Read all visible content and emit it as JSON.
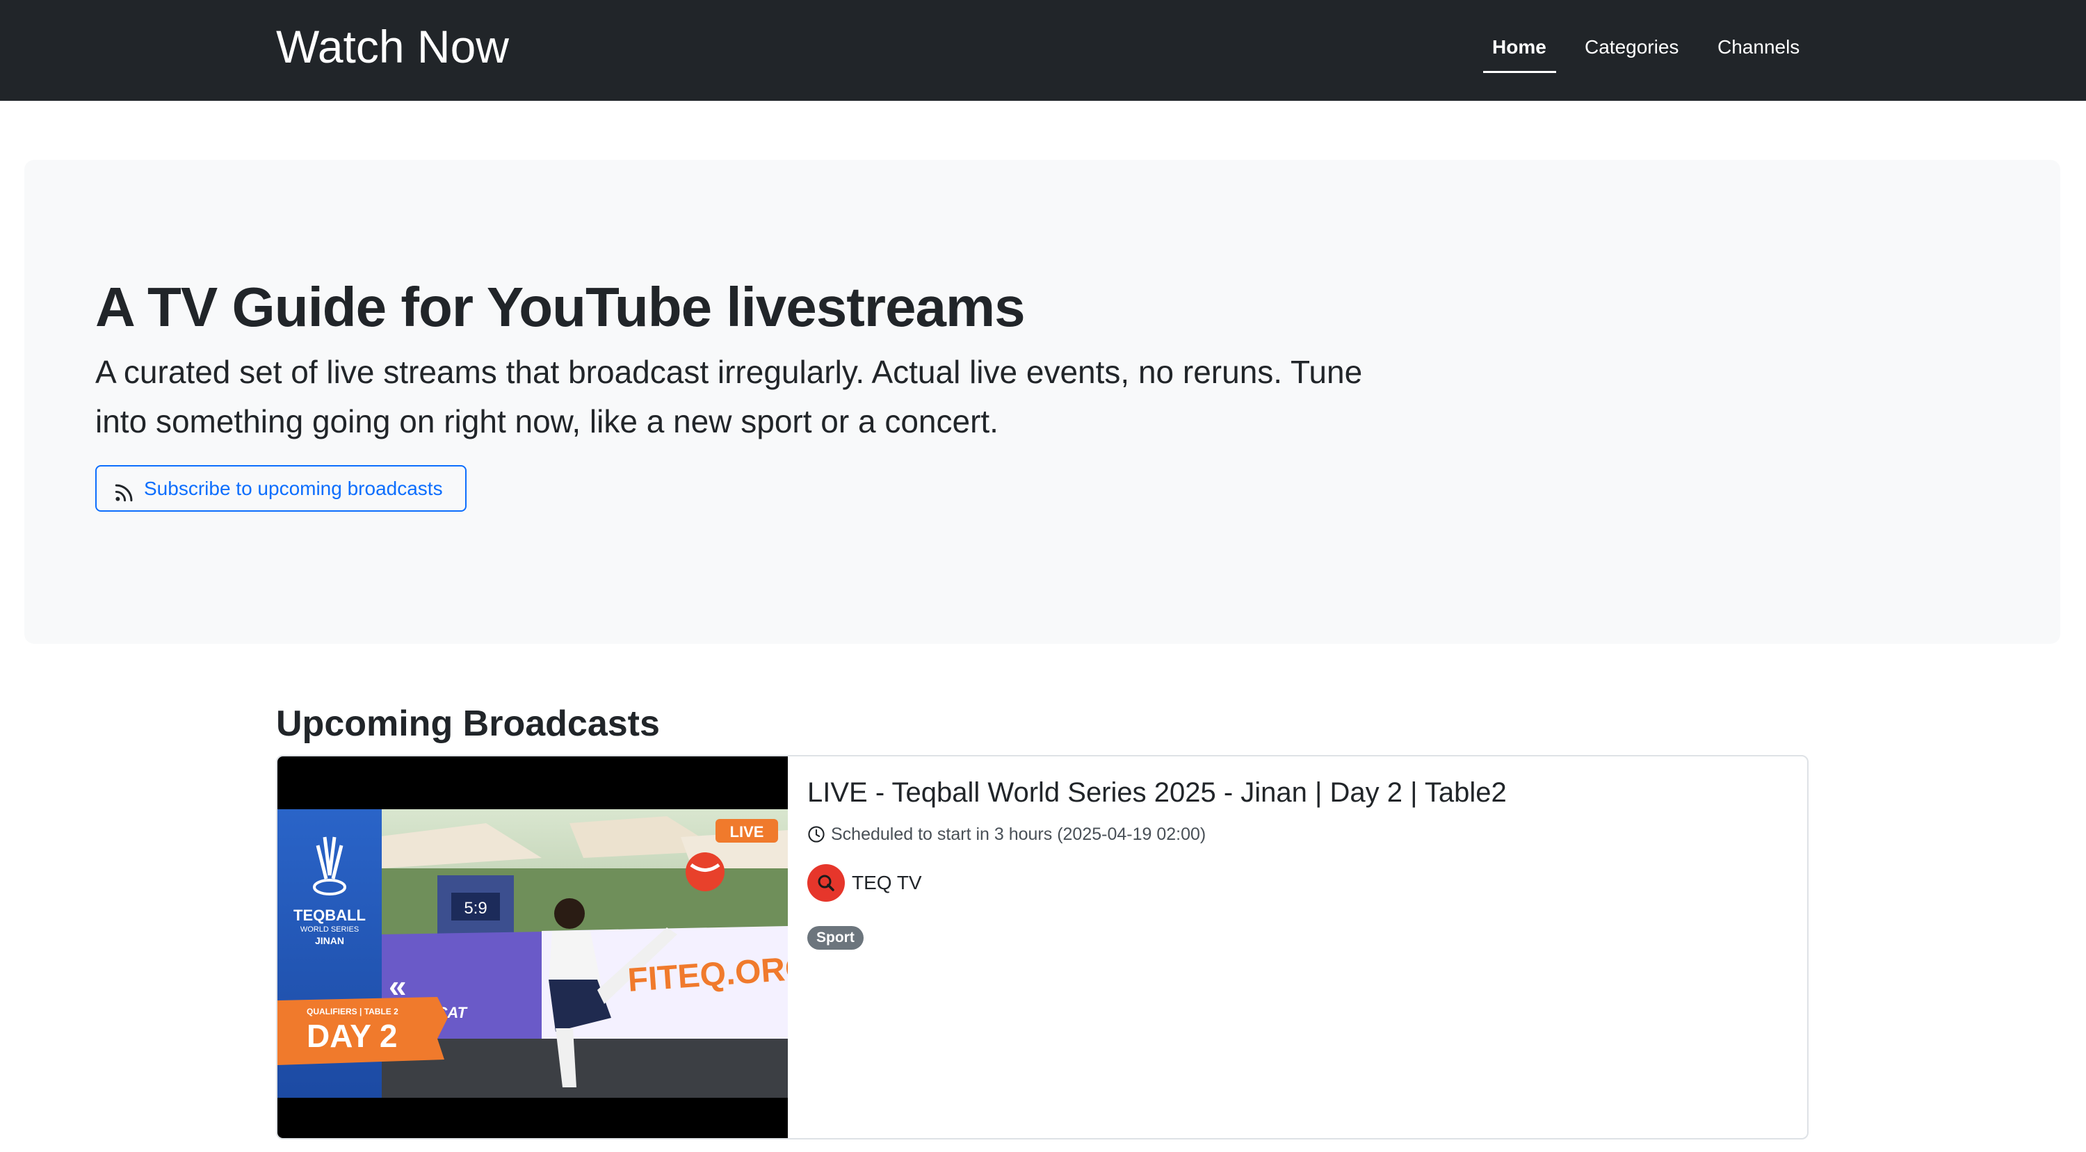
{
  "header": {
    "brand": "Watch Now",
    "nav": [
      {
        "label": "Home",
        "active": true
      },
      {
        "label": "Categories",
        "active": false
      },
      {
        "label": "Channels",
        "active": false
      }
    ]
  },
  "hero": {
    "title": "A TV Guide for YouTube livestreams",
    "lead": "A curated set of live streams that broadcast irregularly. Actual live events, no reruns. Tune into something going on right now, like a new sport or a concert.",
    "subscribe_label": "Subscribe to upcoming broadcasts",
    "subscribe_icon": "rss-icon"
  },
  "upcoming": {
    "heading": "Upcoming Broadcasts",
    "items": [
      {
        "title": "LIVE - Teqball World Series 2025 - Jinan | Day 2 | Table2",
        "schedule": "Scheduled to start in 3 hours (2025-04-19 02:00)",
        "channel": "TEQ TV",
        "category": "Sport",
        "thumbnail": {
          "logo_text": "TEQBALL",
          "logo_sub": "WORLD SERIES",
          "city": "JINAN",
          "live_tag": "LIVE",
          "score": "5:9",
          "qualifier_text": "QUALIFIERS | TABLE 2",
          "day_text": "DAY 2",
          "banner_text": "FITEQ.ORG",
          "sponsor_text": "CYNDICAT"
        }
      }
    ]
  },
  "colors": {
    "navbar_bg": "#212529",
    "hero_bg": "#f8f9fa",
    "accent": "#0d6efd",
    "badge_bg": "#6c757d",
    "channel_avatar": "#e6362b"
  }
}
